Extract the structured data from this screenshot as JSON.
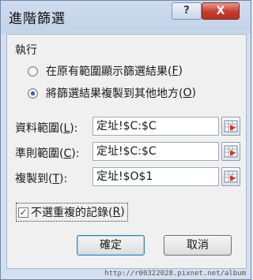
{
  "window": {
    "title": "進階篩選",
    "help_label": "?",
    "close_label": "X"
  },
  "action": {
    "label": "執行",
    "options": [
      {
        "text": "在原有範圍顯示篩選結果(",
        "key": "F",
        "suffix": ")",
        "checked": false
      },
      {
        "text": "將篩選結果複製到其他地方(",
        "key": "O",
        "suffix": ")",
        "checked": true
      }
    ]
  },
  "fields": {
    "list_range": {
      "label": "資料範圍(",
      "key": "L",
      "suffix": "):",
      "value": "定址!$C:$C"
    },
    "criteria_range": {
      "label": "準則範圍(",
      "key": "C",
      "suffix": "):",
      "value": "定址!$C:$C"
    },
    "copy_to": {
      "label": "複製到(",
      "key": "T",
      "suffix": "):",
      "value": "定址!$O$1"
    }
  },
  "unique": {
    "label": "不選重複的記錄(",
    "key": "R",
    "suffix": ")",
    "checked": true,
    "mark": "✓"
  },
  "buttons": {
    "ok": "確定",
    "cancel": "取消"
  },
  "watermark": "http://r00322028.pixnet.net/album",
  "colors": {
    "title_bar": "#c6d6ea",
    "client": "#f0f0f0",
    "close": "#c63b2a"
  },
  "icons": {
    "range_selector": "range-selector-icon"
  }
}
